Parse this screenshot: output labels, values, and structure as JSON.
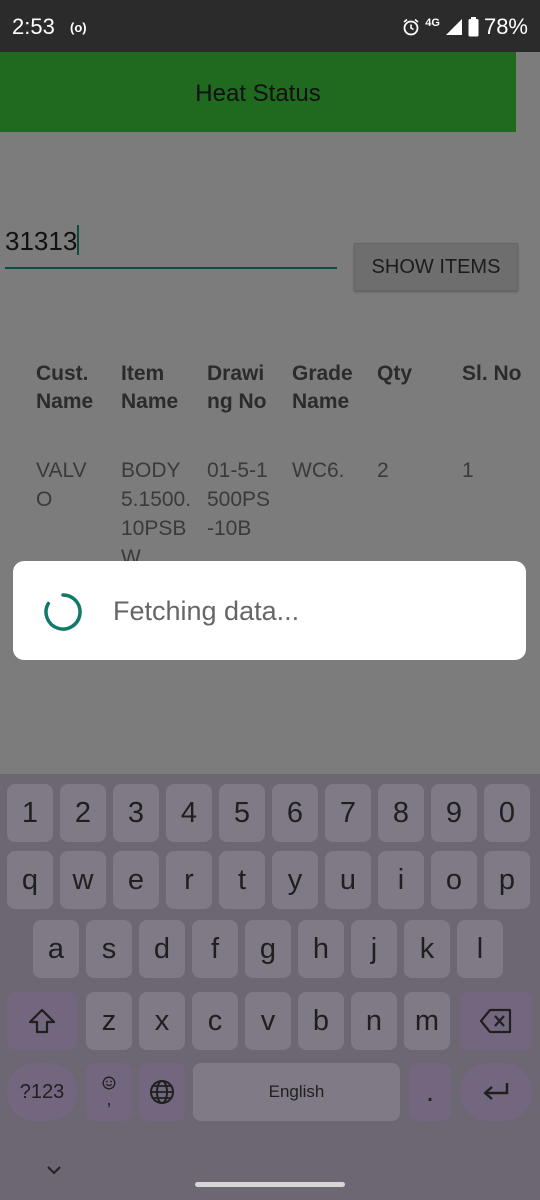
{
  "status_bar": {
    "time": "2:53",
    "radio_indicator": "(o)",
    "network": "4G",
    "battery": "78%",
    "icons": [
      "alarm-icon",
      "signal-icon",
      "battery-icon"
    ]
  },
  "app": {
    "title": "Heat Status",
    "heat_input_value": "31313",
    "show_items_label": "SHOW ITEMS",
    "table": {
      "headers": [
        "Cust. Name",
        "Item Name",
        "Drawing No",
        "Grade Name",
        "Qty",
        "Sl. No"
      ],
      "row": [
        "VALVO",
        "BODY 5.1500.10PSBW",
        "01-5-1500PS-10B",
        "WC6.",
        "2",
        "1"
      ]
    }
  },
  "dialog": {
    "message": "Fetching data...",
    "accent": "#11786a"
  },
  "keyboard": {
    "number_row": [
      "1",
      "2",
      "3",
      "4",
      "5",
      "6",
      "7",
      "8",
      "9",
      "0"
    ],
    "row1": [
      "q",
      "w",
      "e",
      "r",
      "t",
      "y",
      "u",
      "i",
      "o",
      "p"
    ],
    "row2": [
      "a",
      "s",
      "d",
      "f",
      "g",
      "h",
      "j",
      "k",
      "l"
    ],
    "row3": [
      "z",
      "x",
      "c",
      "v",
      "b",
      "n",
      "m"
    ],
    "symbols_label": "?123",
    "emoji_comma_label": ",",
    "space_label": "English",
    "period_label": "."
  }
}
